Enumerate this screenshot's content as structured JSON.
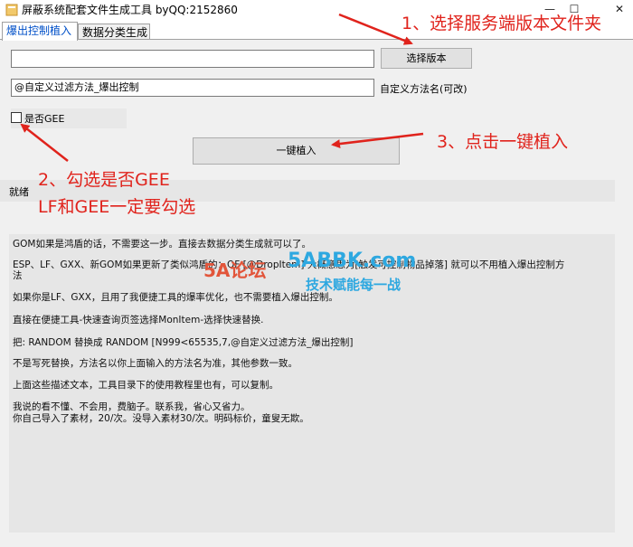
{
  "window": {
    "title": "屏蔽系统配套文件生成工具 byQQ:2152860"
  },
  "tabs": [
    {
      "label": "爆出控制植入"
    },
    {
      "label": "数据分类生成"
    }
  ],
  "form": {
    "version_path_value": "",
    "select_version_label": "选择版本",
    "method_name_value": "@自定义过滤方法_爆出控制",
    "method_name_hint": "自定义方法名(可改)",
    "gee_checkbox_label": "是否GEE",
    "implant_button_label": "一键植入"
  },
  "status": {
    "text": "就绪"
  },
  "info": {
    "lines": [
      "GOM如果是鸿盾的话，不需要这一步。直接去数据分类生成就可以了。",
      "ESP、LF、GXX、新GOM如果更新了类似鸿盾的：QF [@DropItem] 大概意思为[触发可控制物品掉落] 就可以不用植入爆出控制方",
      "法",
      "如果你是LF、GXX，且用了我便捷工具的爆率优化，也不需要植入爆出控制。",
      "直接在便捷工具-快速查询页签选择MonItem-选择快速替换.",
      "把:  RANDOM 替换成  RANDOM [N999<65535,7,@自定义过滤方法_爆出控制]",
      "不是写死替换，方法名以你上面输入的方法名为准，其他参数一致。",
      "上面这些描述文本，工具目录下的使用教程里也有，可以复制。",
      "我说的看不懂、不会用，费脑子。联系我，省心又省力。",
      "你自己导入了素材，20/次。没导入素材30/次。明码标价，童叟无欺。"
    ]
  },
  "annotations": {
    "step1": "1、选择服务端版本文件夹",
    "step2_line1": "2、勾选是否GEE",
    "step2_line2": "LF和GEE一定要勾选",
    "step3": "3、点击一键植入"
  },
  "watermark": {
    "site": "5ABBK.com",
    "slogan": "技术赋能每一战",
    "brand": "5A论坛"
  },
  "colors": {
    "annotation": "#e0231c",
    "active_tab": "#0050c8"
  }
}
